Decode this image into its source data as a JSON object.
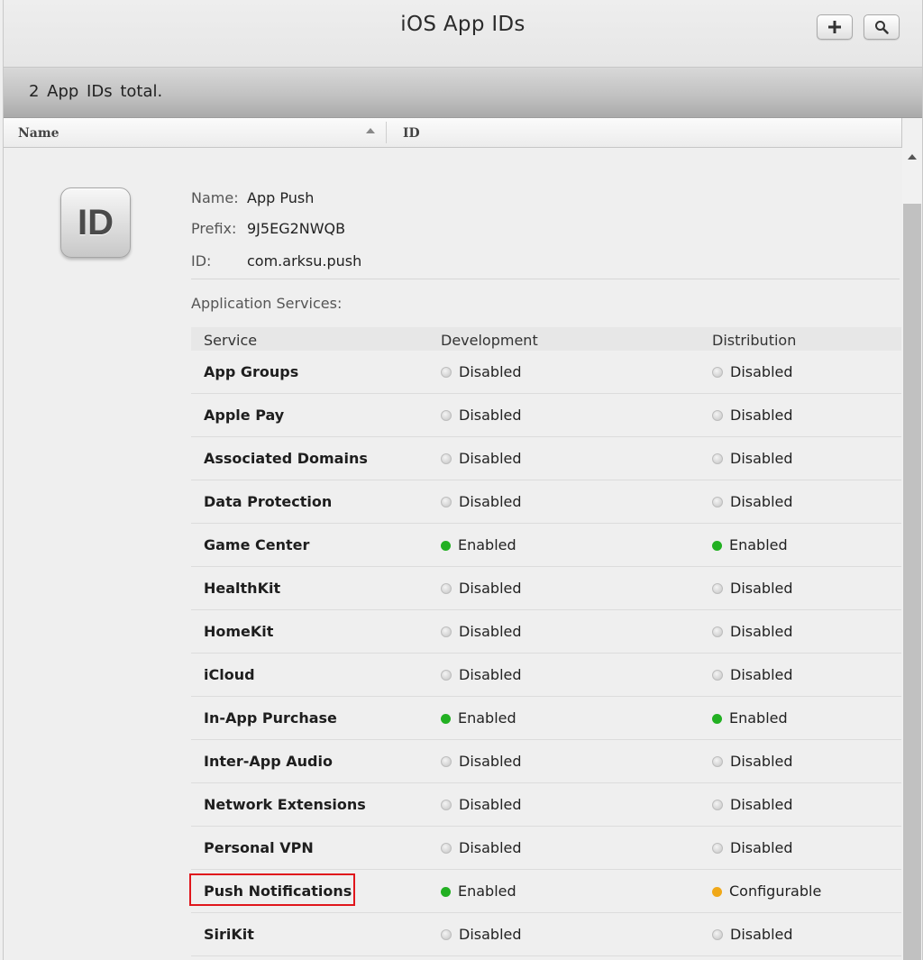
{
  "header": {
    "title": "iOS App IDs",
    "add_icon": "plus-icon",
    "search_icon": "search-icon"
  },
  "summary": {
    "total_text": "2  App IDs total."
  },
  "columns": {
    "name": "Name",
    "id": "ID"
  },
  "detail": {
    "icon_text": "ID",
    "name_label": "Name:",
    "name_value": "App Push",
    "prefix_label": "Prefix:",
    "prefix_value": "9J5EG2NWQB",
    "id_label": "ID:",
    "id_value": "com.arksu.push",
    "services_title": "Application Services:"
  },
  "services_table": {
    "headers": [
      "Service",
      "Development",
      "Distribution"
    ],
    "rows": [
      {
        "service": "App Groups",
        "development": "Disabled",
        "distribution": "Disabled"
      },
      {
        "service": "Apple Pay",
        "development": "Disabled",
        "distribution": "Disabled"
      },
      {
        "service": "Associated Domains",
        "development": "Disabled",
        "distribution": "Disabled"
      },
      {
        "service": "Data Protection",
        "development": "Disabled",
        "distribution": "Disabled"
      },
      {
        "service": "Game Center",
        "development": "Enabled",
        "distribution": "Enabled"
      },
      {
        "service": "HealthKit",
        "development": "Disabled",
        "distribution": "Disabled"
      },
      {
        "service": "HomeKit",
        "development": "Disabled",
        "distribution": "Disabled"
      },
      {
        "service": "iCloud",
        "development": "Disabled",
        "distribution": "Disabled"
      },
      {
        "service": "In-App Purchase",
        "development": "Enabled",
        "distribution": "Enabled"
      },
      {
        "service": "Inter-App Audio",
        "development": "Disabled",
        "distribution": "Disabled"
      },
      {
        "service": "Network Extensions",
        "development": "Disabled",
        "distribution": "Disabled"
      },
      {
        "service": "Personal VPN",
        "development": "Disabled",
        "distribution": "Disabled"
      },
      {
        "service": "Push Notifications",
        "development": "Enabled",
        "distribution": "Configurable",
        "highlighted": true
      },
      {
        "service": "SiriKit",
        "development": "Disabled",
        "distribution": "Disabled"
      }
    ]
  },
  "status_colors": {
    "Enabled": "#22b022",
    "Configurable": "#f0a818",
    "Disabled": "#c4c4c4",
    "highlight": "#e0161c"
  }
}
